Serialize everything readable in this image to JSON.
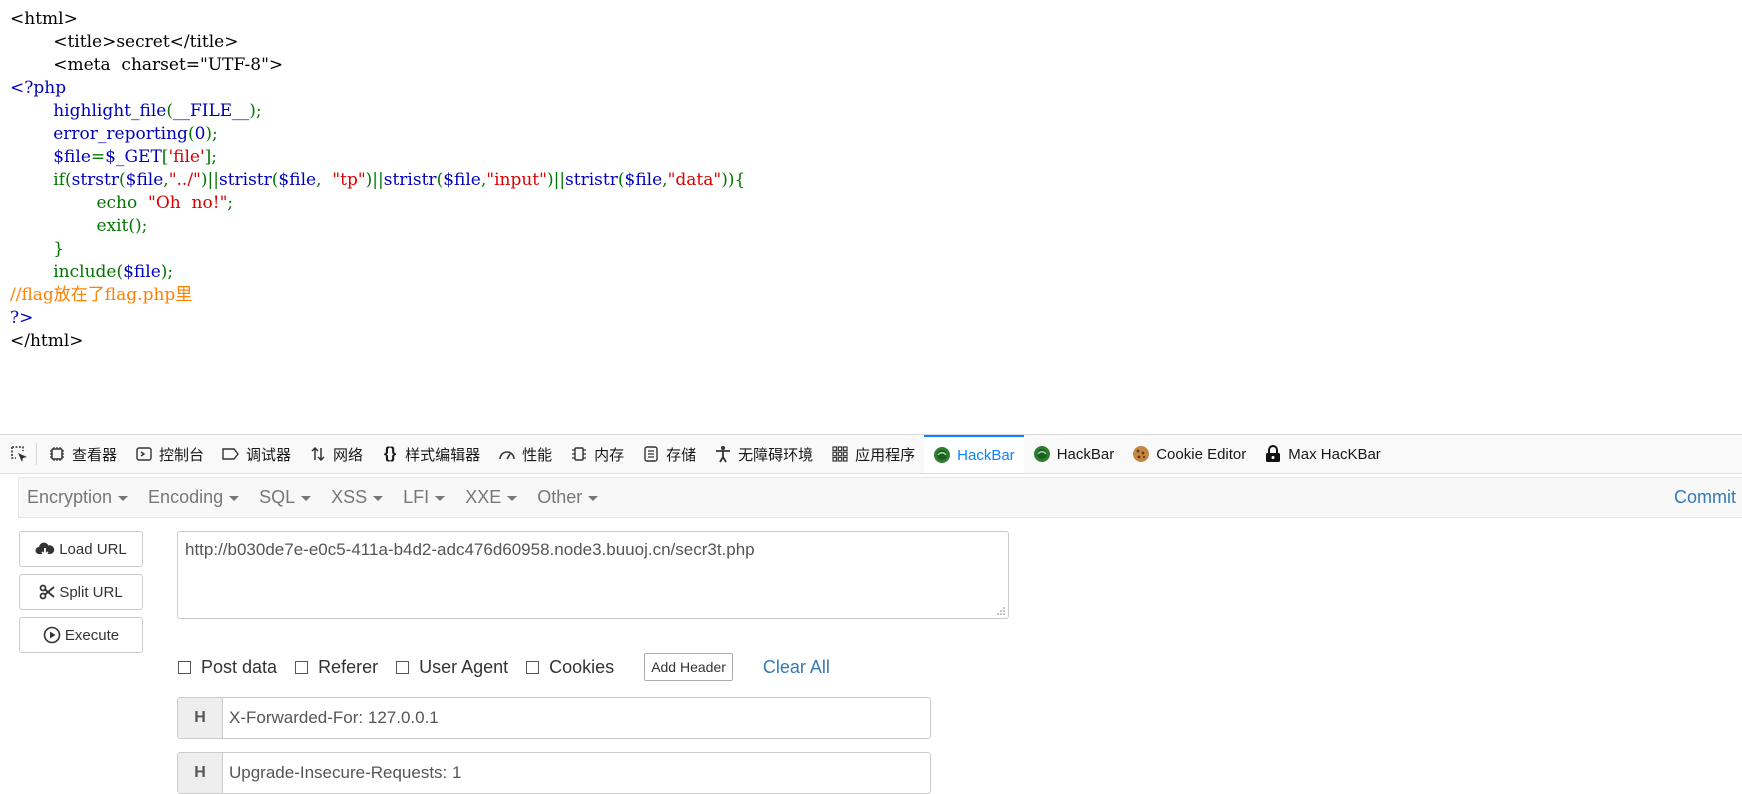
{
  "source": {
    "html_open": "<html>",
    "title_line": "<title>secret</title>",
    "meta_line": "<meta  charset=\"UTF-8\">",
    "php_open": "<?php",
    "highlight_fn": "highlight_file",
    "highlight_arg_open": "(",
    "highlight_arg": "__FILE__",
    "highlight_arg_close": ");",
    "error_fn": "error_reporting",
    "error_open": "(",
    "error_arg": "0",
    "error_close": ");",
    "file_var": "$file",
    "file_eq": "=",
    "get_var": "$_GET",
    "bracket_open": "[",
    "file_key": "'file'",
    "bracket_close": "];",
    "if_kw": "if(",
    "fn_strstr": "strstr",
    "p1": "(",
    "v1": "$file",
    "c1": ",",
    "s1": "\"../\"",
    "or1": ")||",
    "fn_stristr1": "stristr",
    "p2": "(",
    "v2": "$file",
    "c2": ",  ",
    "s2": "\"tp\"",
    "or2": ")||",
    "fn_stristr2": "stristr",
    "p3": "(",
    "v3": "$file",
    "c3": ",",
    "s3": "\"input\"",
    "or3": ")||",
    "fn_stristr3": "stristr",
    "p4": "(",
    "v4": "$file",
    "c4": ",",
    "s4": "\"data\"",
    "if_close": ")){",
    "echo_kw": "echo  ",
    "echo_str": "\"Oh  no!\"",
    "echo_end": ";",
    "exit_line": "exit();",
    "brace_close": "}",
    "include_kw": "include(",
    "include_var": "$file",
    "include_end": ");",
    "comment": "//flag放在了flag.php里",
    "php_close": "?>",
    "html_close": "</html>"
  },
  "devtools": {
    "tabs": [
      {
        "label": "查看器",
        "icon": "inspector-icon"
      },
      {
        "label": "控制台",
        "icon": "console-icon"
      },
      {
        "label": "调试器",
        "icon": "debugger-icon"
      },
      {
        "label": "网络",
        "icon": "network-icon"
      },
      {
        "label": "样式编辑器",
        "icon": "style-editor-icon"
      },
      {
        "label": "性能",
        "icon": "performance-icon"
      },
      {
        "label": "内存",
        "icon": "memory-icon"
      },
      {
        "label": "存储",
        "icon": "storage-icon"
      },
      {
        "label": "无障碍环境",
        "icon": "accessibility-icon"
      },
      {
        "label": "应用程序",
        "icon": "application-icon"
      },
      {
        "label": "HackBar",
        "icon": "hackbar-icon",
        "active": true
      },
      {
        "label": "HackBar",
        "icon": "hackbar-icon"
      },
      {
        "label": "Cookie Editor",
        "icon": "cookie-icon"
      },
      {
        "label": "Max HacKBar",
        "icon": "lock-icon"
      }
    ],
    "accent_color": "#0a84ff"
  },
  "hackbar": {
    "menu": [
      "Encryption",
      "Encoding",
      "SQL",
      "XSS",
      "LFI",
      "XXE",
      "Other"
    ],
    "commit": "Commit",
    "buttons": {
      "load_url": "Load URL",
      "split_url": "Split URL",
      "execute": "Execute"
    },
    "url": "http://b030de7e-e0c5-411a-b4d2-adc476d60958.node3.buuoj.cn/secr3t.php",
    "options": {
      "post_data": "Post data",
      "referer": "Referer",
      "user_agent": "User Agent",
      "cookies": "Cookies",
      "add_header": "Add Header",
      "clear_all": "Clear All"
    },
    "headers": [
      {
        "tag": "H",
        "value": "X-Forwarded-For: 127.0.0.1"
      },
      {
        "tag": "H",
        "value": "Upgrade-Insecure-Requests: 1"
      }
    ]
  }
}
